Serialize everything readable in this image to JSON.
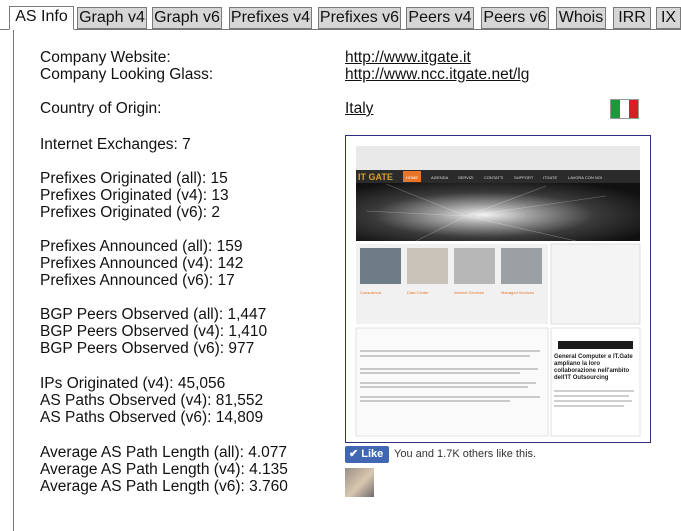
{
  "tabs": [
    "AS Info",
    "Graph v4",
    "Graph v6",
    "Prefixes v4",
    "Prefixes v6",
    "Peers v4",
    "Peers v6",
    "Whois",
    "IRR",
    "IX"
  ],
  "info": {
    "company_website_label": "Company Website:",
    "company_website": "http://www.itgate.it",
    "looking_glass_label": "Company Looking Glass:",
    "looking_glass": "http://www.ncc.itgate.net/lg",
    "country_label": "Country of Origin:",
    "country": "Italy"
  },
  "stats": [
    "Internet Exchanges: 7",
    "Prefixes Originated (all): 15",
    "Prefixes Originated (v4): 13",
    "Prefixes Originated (v6): 2",
    "Prefixes Announced (all): 159",
    "Prefixes Announced (v4): 142",
    "Prefixes Announced (v6): 17",
    "BGP Peers Observed (all): 1,447",
    "BGP Peers Observed (v4): 1,410",
    "BGP Peers Observed (v6): 977",
    "IPs Originated (v4): 45,056",
    "AS Paths Observed (v4): 81,552",
    "AS Paths Observed (v6): 14,809",
    "Average AS Path Length (all): 4.077",
    "Average AS Path Length (v4): 4.135",
    "Average AS Path Length (v6): 3.760"
  ],
  "flag_colors": [
    "#1a9a3a",
    "#ffffff",
    "#d81f26"
  ],
  "website_preview": {
    "logo": "IT GATE",
    "nav": [
      "HOME",
      "AZIENDA",
      "SERVIZI",
      "CONTATTI",
      "SUPPORT",
      "ITGATE",
      "LAVORA CON NOI"
    ],
    "tiles": [
      "Consulenza",
      "Data Center",
      "Internet Services",
      "Managed Services"
    ],
    "news_title": "General Computer e IT.Gate ampliano la loro collaborazione nell'ambito dell'IT Outsourcing"
  },
  "like": {
    "button": "Like",
    "text": "You and 1.7K others like this."
  },
  "colors": {
    "tab_bg": "#d6d6d6",
    "like_blue": "#4267b2"
  }
}
